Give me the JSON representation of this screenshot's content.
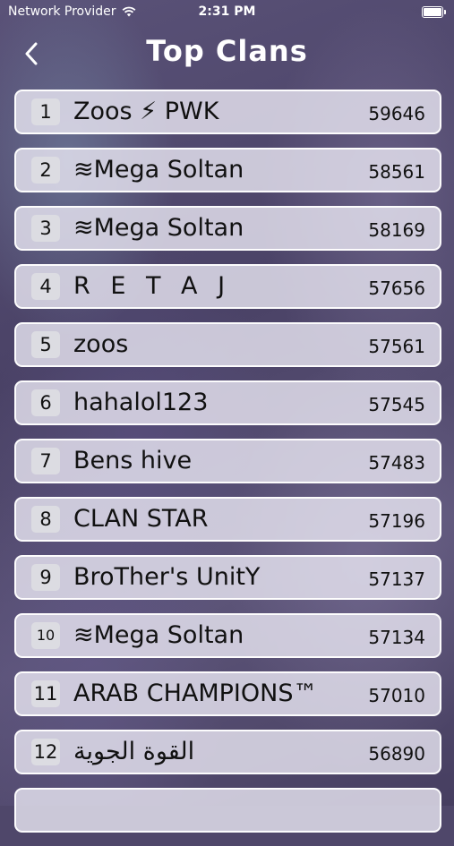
{
  "status": {
    "carrier": "Network Provider",
    "time": "2:31 PM",
    "wifi_icon": "wifi-icon",
    "battery_icon": "battery-icon"
  },
  "nav": {
    "title": "Top Clans",
    "back_icon": "chevron-left-icon"
  },
  "clans": [
    {
      "rank": "1",
      "name": "Zoos ⚡ PWK",
      "score": "59646"
    },
    {
      "rank": "2",
      "name": "≋Mega Soltan",
      "score": "58561"
    },
    {
      "rank": "3",
      "name": "≋Mega Soltan",
      "score": "58169"
    },
    {
      "rank": "4",
      "name": "R E T A J",
      "score": "57656"
    },
    {
      "rank": "5",
      "name": "zoos",
      "score": "57561"
    },
    {
      "rank": "6",
      "name": "hahalol123",
      "score": "57545"
    },
    {
      "rank": "7",
      "name": "Bens hive",
      "score": "57483"
    },
    {
      "rank": "8",
      "name": "CLAN STAR",
      "score": "57196"
    },
    {
      "rank": "9",
      "name": "BroTher's UnitY",
      "score": "57137"
    },
    {
      "rank": "10",
      "name": "≋Mega Soltan",
      "score": "57134"
    },
    {
      "rank": "11",
      "name": "ARAB CHAMPIONS™",
      "score": "57010"
    },
    {
      "rank": "12",
      "name": "القوة الجوية",
      "score": "56890"
    }
  ]
}
